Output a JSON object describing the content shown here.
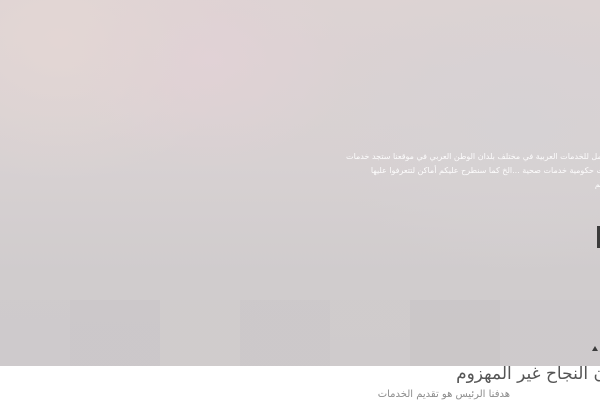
{
  "hero": {
    "lines": [
      "امل للخدمات العربية في مختلف بلدان الوطن العربي في موقعنا ستجد خدمات",
      "ت حكومية خدمات صحية ...الخ كما سنطرح عليكم أماكن لتتعرفوا عليها",
      "كم"
    ]
  },
  "section": {
    "heading": "ن النجاح غير المهزوم",
    "subheading": "هدفنا الرئيس هو تقديم الخدمات"
  },
  "colors": {
    "hero_background": "#d7d1d2",
    "hero_text": "#ffffff",
    "heading": "#555555",
    "subheading": "#8c8c8c"
  }
}
